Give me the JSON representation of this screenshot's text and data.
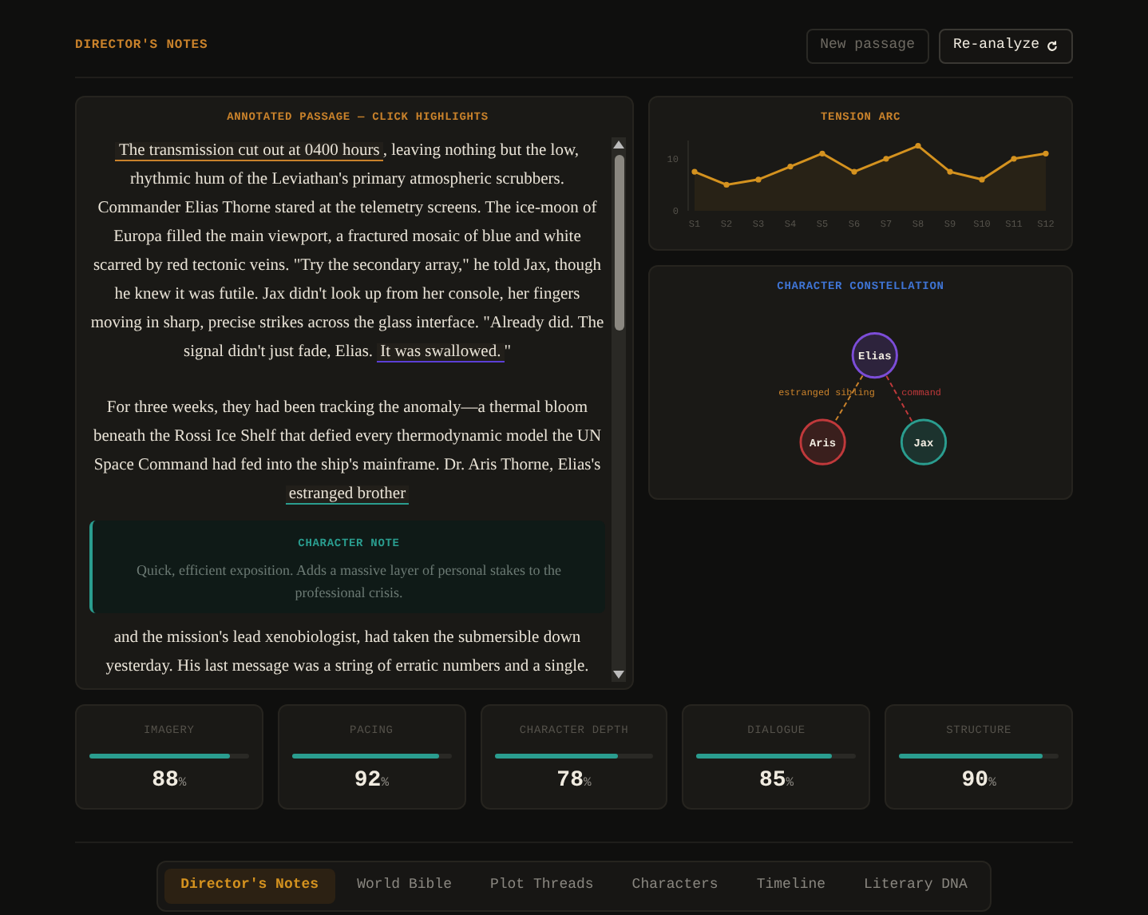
{
  "header": {
    "title": "DIRECTOR'S NOTES",
    "buttons": [
      {
        "label": "New passage",
        "kind": "ghost"
      },
      {
        "label": "Re-analyze",
        "kind": "primary"
      }
    ]
  },
  "passage": {
    "title": "ANNOTATED PASSAGE — CLICK HIGHLIGHTS",
    "blocks": [
      {
        "kind": "paragraph",
        "segments": [
          {
            "kind": "highlight",
            "text": "The transmission cut out at 0400 hours",
            "color": "#c9822b"
          },
          {
            "kind": "plain",
            "text": ", leaving nothing but the low, rhythmic hum of the Leviathan's primary atmospheric scrubbers. Commander Elias Thorne stared at the telemetry screens. The ice-moon of Europa filled the main viewport, a fractured mosaic of blue and white scarred by red tectonic veins. \"Try the secondary array,\" he told Jax, though he knew it was futile. Jax didn't look up from her console, her fingers moving in sharp, precise strikes across the glass interface. \"Already did. The signal didn't just fade, Elias. "
          },
          {
            "kind": "highlight",
            "text": "It was swallowed.",
            "color": "#5b3fd6"
          },
          {
            "kind": "plain",
            "text": "\""
          }
        ]
      },
      {
        "kind": "paragraph",
        "segments": [
          {
            "kind": "plain",
            "text": "For three weeks, they had been tracking the anomaly—a thermal bloom beneath the Rossi Ice Shelf that defied every thermodynamic model the UN Space Command had fed into the ship's mainframe. Dr. Aris Thorne, Elias's "
          },
          {
            "kind": "highlight",
            "text": "estranged brother",
            "color": "#2a9d8f"
          }
        ]
      },
      {
        "kind": "note",
        "title": "CHARACTER NOTE",
        "text": "Quick, efficient exposition. Adds a massive layer of personal stakes to the professional crisis."
      },
      {
        "kind": "paragraph",
        "segments": [
          {
            "kind": "plain",
            "text": "and the mission's lead xenobiologist, had taken the submersible down yesterday. His last message was a string of erratic numbers and a single."
          }
        ]
      }
    ]
  },
  "tension": {
    "title": "TENSION ARC",
    "chart_data": {
      "type": "area",
      "categories": [
        "S1",
        "S2",
        "S3",
        "S4",
        "S5",
        "S6",
        "S7",
        "S8",
        "S9",
        "S10",
        "S11",
        "S12"
      ],
      "series": [
        {
          "color": "#d4921f",
          "values": [
            7.5,
            5,
            6,
            8.5,
            11,
            7.5,
            10,
            12.5,
            7.5,
            6,
            10,
            11
          ]
        }
      ],
      "ylim": [
        0,
        13.5
      ],
      "yticks": [
        0,
        10
      ]
    }
  },
  "constellation": {
    "title": "CHARACTER CONSTELLATION",
    "nodes": [
      {
        "name": "Elias",
        "color": "#7c4dd8"
      },
      {
        "name": "Aris",
        "color": "#c0393b"
      },
      {
        "name": "Jax",
        "color": "#2a9d8f"
      }
    ],
    "edges": [
      {
        "label": "estranged sibling",
        "color": "#c9822b"
      },
      {
        "label": "command",
        "color": "#c0393b"
      }
    ]
  },
  "metrics": [
    {
      "label": "IMAGERY",
      "level": 0.88,
      "value": "88",
      "unit": "%"
    },
    {
      "label": "PACING",
      "level": 0.92,
      "value": "92",
      "unit": "%"
    },
    {
      "label": "CHARACTER DEPTH",
      "level": 0.78,
      "value": "78",
      "unit": "%"
    },
    {
      "label": "DIALOGUE",
      "level": 0.85,
      "value": "85",
      "unit": "%"
    },
    {
      "label": "STRUCTURE",
      "level": 0.9,
      "value": "90",
      "unit": "%"
    }
  ],
  "tabs": [
    {
      "label": "Director's Notes",
      "selected": true
    },
    {
      "label": "World Bible",
      "selected": false
    },
    {
      "label": "Plot Threads",
      "selected": false
    },
    {
      "label": "Characters",
      "selected": false
    },
    {
      "label": "Timeline",
      "selected": false
    },
    {
      "label": "Literary DNA",
      "selected": false
    }
  ]
}
